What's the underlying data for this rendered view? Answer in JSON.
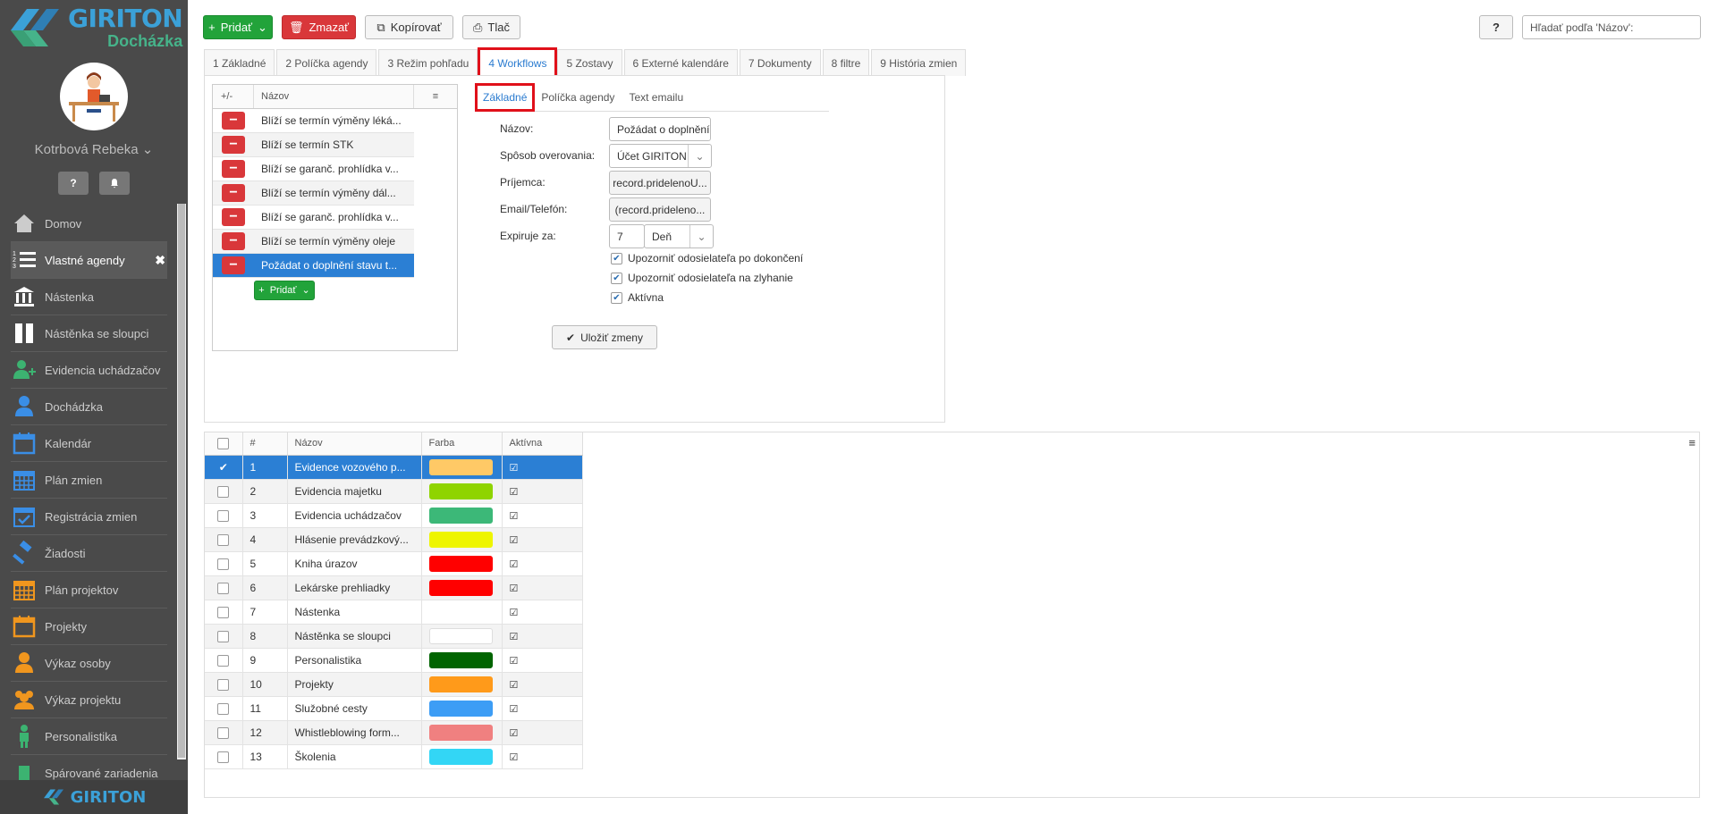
{
  "sidebar": {
    "brand": "GIRITON",
    "brand_sub": "Docházka",
    "user": "Kotrbová Rebeka",
    "items": [
      {
        "label": "Domov",
        "icon": "home-icon",
        "color": "#cccccc"
      },
      {
        "label": "Vlastné agendy",
        "icon": "list-icon",
        "color": "#ffffff"
      },
      {
        "label": "Nástenka",
        "icon": "bank-icon",
        "color": "#ffffff"
      },
      {
        "label": "Nástěnka se sloupci",
        "icon": "columns-icon",
        "color": "#ffffff"
      },
      {
        "label": "Evidencia uchádzačov",
        "icon": "user-plus-icon",
        "color": "#3cb371"
      },
      {
        "label": "Dochádzka",
        "icon": "user-icon",
        "color": "#3a8ee6"
      },
      {
        "label": "Kalendár",
        "icon": "calendar-icon",
        "color": "#3a8ee6"
      },
      {
        "label": "Plán zmien",
        "icon": "calendar-grid-icon",
        "color": "#3a8ee6"
      },
      {
        "label": "Registrácia zmien",
        "icon": "calendar-check-icon",
        "color": "#3a8ee6"
      },
      {
        "label": "Žiadosti",
        "icon": "gavel-icon",
        "color": "#3a8ee6"
      },
      {
        "label": "Plán projektov",
        "icon": "calendar-grid-icon",
        "color": "#f0961e"
      },
      {
        "label": "Projekty",
        "icon": "calendar-icon",
        "color": "#f0961e"
      },
      {
        "label": "Výkaz osoby",
        "icon": "user-icon",
        "color": "#f0961e"
      },
      {
        "label": "Výkaz projektu",
        "icon": "users-icon",
        "color": "#f0961e"
      },
      {
        "label": "Personalistika",
        "icon": "person-icon",
        "color": "#3cb371"
      },
      {
        "label": "Spárované zariadenia",
        "icon": "device-icon",
        "color": "#3cb371"
      }
    ],
    "footer": "GIRITON"
  },
  "toolbar": {
    "add": "Pridať",
    "delete": "Zmazať",
    "copy": "Kopírovať",
    "print": "Tlač",
    "help": "?",
    "search_placeholder": "Hľadať podľa 'Názov':"
  },
  "tabs": [
    "1 Základné",
    "2 Políčka agendy",
    "3 Režim pohľadu",
    "4 Workflows",
    "5 Zostavy",
    "6 Externé kalendáre",
    "7 Dokumenty",
    "8 filtre",
    "9 História zmien"
  ],
  "workflows": {
    "col_action": "+/-",
    "col_name": "Názov",
    "rows": [
      "Blíží se termín výměny léká...",
      "Blíží se termín STK",
      "Blíží se garanč. prohlídka v...",
      "Blíží se termín výměny dál...",
      "Blíží se garanč. prohlídka v...",
      "Blíží se termín výměny oleje",
      "Požádat o doplnění stavu t..."
    ],
    "add": "Pridať"
  },
  "subtabs": [
    "Základné",
    "Políčka agendy",
    "Text emailu"
  ],
  "form": {
    "name_label": "Názov:",
    "name_value": "Požádat o doplnění sta",
    "verify_label": "Spôsob overovania:",
    "verify_value": "Účet GIRITON",
    "recipient_label": "Príjemca:",
    "recipient_value": "record.pridelenoU...",
    "email_label": "Email/Telefón:",
    "email_value": "(record.prideleno...",
    "expire_label": "Expiruje za:",
    "expire_value": "7",
    "expire_unit": "Deň",
    "cb1": "Upozorniť odosielateľa po dokončení",
    "cb2": "Upozorniť odosielateľa na zlyhanie",
    "cb3": "Aktívna",
    "save": "Uložiť zmeny"
  },
  "grid": {
    "headers": [
      "#",
      "Názov",
      "Farba",
      "Aktívna"
    ],
    "rows": [
      {
        "n": "1",
        "name": "Evidence vozového p...",
        "color": "#ffc966"
      },
      {
        "n": "2",
        "name": "Evidencia majetku",
        "color": "#8fd400"
      },
      {
        "n": "3",
        "name": "Evidencia uchádzačov",
        "color": "#3cb878"
      },
      {
        "n": "4",
        "name": "Hlásenie prevádzkový...",
        "color": "#eef500"
      },
      {
        "n": "5",
        "name": "Kniha úrazov",
        "color": "#ff0000"
      },
      {
        "n": "6",
        "name": "Lekárske prehliadky",
        "color": "#ff0000"
      },
      {
        "n": "7",
        "name": "Nástenka",
        "color": ""
      },
      {
        "n": "8",
        "name": "Nástěnka se sloupci",
        "color": "#ffffff"
      },
      {
        "n": "9",
        "name": "Personalistika",
        "color": "#006400"
      },
      {
        "n": "10",
        "name": "Projekty",
        "color": "#ff9a1a"
      },
      {
        "n": "11",
        "name": "Služobné cesty",
        "color": "#3d9df5"
      },
      {
        "n": "12",
        "name": "Whistleblowing form...",
        "color": "#f08080"
      },
      {
        "n": "13",
        "name": "Školenia",
        "color": "#33d6f5"
      }
    ]
  }
}
